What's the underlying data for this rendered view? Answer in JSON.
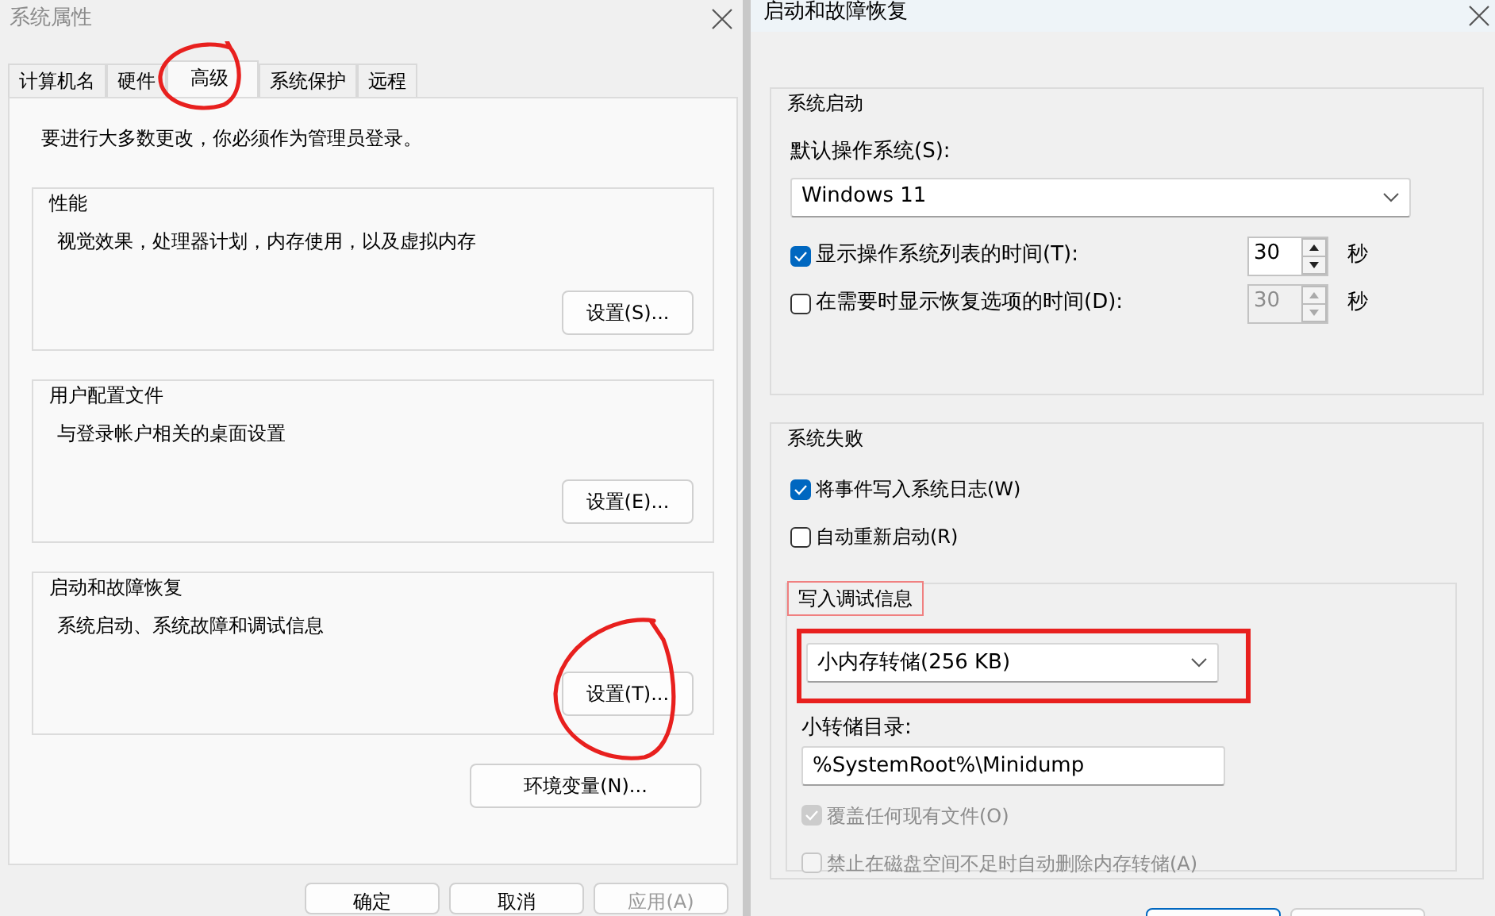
{
  "left_window": {
    "title": "系统属性",
    "tabs": [
      {
        "label": "计算机名",
        "selected": false,
        "circled": false
      },
      {
        "label": "硬件",
        "selected": false,
        "circled": false
      },
      {
        "label": "高级",
        "selected": true,
        "circled": true
      },
      {
        "label": "系统保护",
        "selected": false,
        "circled": false
      },
      {
        "label": "远程",
        "selected": false,
        "circled": false
      }
    ],
    "notice": "要进行大多数更改，你必须作为管理员登录。",
    "groups": [
      {
        "title": "性能",
        "description": "视觉效果，处理器计划，内存使用，以及虚拟内存",
        "button": "设置(S)...",
        "circled": false
      },
      {
        "title": "用户配置文件",
        "description": "与登录帐户相关的桌面设置",
        "button": "设置(E)...",
        "circled": false
      },
      {
        "title": "启动和故障恢复",
        "description": "系统启动、系统故障和调试信息",
        "button": "设置(T)...",
        "circled": true
      }
    ],
    "env_button": "环境变量(N)...",
    "footer_buttons": [
      {
        "label": "确定",
        "disabled": false
      },
      {
        "label": "取消",
        "disabled": false
      },
      {
        "label": "应用(A)",
        "disabled": true
      }
    ]
  },
  "right_window": {
    "title": "启动和故障恢复",
    "startup": {
      "title": "系统启动",
      "os_label": "默认操作系统(S):",
      "os_value": "Windows 11",
      "timers": [
        {
          "label": "显示操作系统列表的时间(T):",
          "checked": true,
          "value": "30",
          "unit": "秒"
        },
        {
          "label": "在需要时显示恢复选项的时间(D):",
          "checked": false,
          "value": "30",
          "unit": "秒"
        }
      ]
    },
    "failure": {
      "title": "系统失败",
      "options": [
        {
          "label": "将事件写入系统日志(W)",
          "checked": true
        },
        {
          "label": "自动重新启动(R)",
          "checked": false
        }
      ],
      "debug": {
        "title": "写入调试信息",
        "title_highlighted": true,
        "dump_type": "小内存转储(256 KB)",
        "dump_highlighted": true,
        "dir_label": "小转储目录:",
        "dir_value": "%SystemRoot%\\Minidump",
        "options": [
          {
            "label": "覆盖任何现有文件(O)",
            "checked": true,
            "disabled": true
          },
          {
            "label": "禁止在磁盘空间不足时自动删除内存转储(A)",
            "checked": false,
            "disabled": true
          }
        ]
      }
    },
    "footer_buttons": [
      {
        "default": true
      },
      {
        "default": false
      }
    ]
  }
}
